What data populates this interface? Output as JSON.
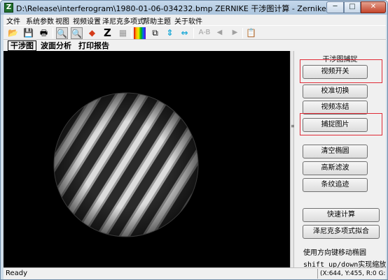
{
  "window": {
    "app_icon_letter": "Z",
    "title": "D:\\Release\\interferogram\\1980-01-06-034232.bmp ZERNIKE 干涉图计算 - Zernike 干涉仪软件",
    "controls": {
      "minimize": "─",
      "maximize": "□",
      "close": "✕"
    }
  },
  "menu": {
    "items": [
      "文件",
      "系统参数",
      "视图",
      "视频设置",
      "泽尼克多项式",
      "帮助主题",
      "关于软件"
    ]
  },
  "toolbar": {
    "buttons": [
      {
        "icon": "open-folder-icon",
        "glyph": "📂"
      },
      {
        "icon": "save-disk-icon",
        "glyph": "💾"
      },
      {
        "icon": "print-icon",
        "glyph": "🖶"
      },
      {
        "icon": "zoom-in-icon",
        "glyph": "🔍"
      },
      {
        "icon": "zoom-out-icon",
        "glyph": "🔍"
      },
      {
        "icon": "paint-icon",
        "glyph": "◆"
      },
      {
        "icon": "zernike-icon",
        "glyph": "Z"
      },
      {
        "icon": "grid-icon",
        "glyph": "▦"
      },
      {
        "icon": "color-bars-icon",
        "glyph": "▮"
      },
      {
        "icon": "cube-3d-icon",
        "glyph": "⧉"
      },
      {
        "icon": "vertical-arrows-icon",
        "glyph": "⇕"
      },
      {
        "icon": "horizontal-arrows-icon",
        "glyph": "⇔"
      },
      {
        "icon": "ab-text-icon",
        "glyph": "A-B"
      },
      {
        "icon": "prev-arrow-icon",
        "glyph": "◀"
      },
      {
        "icon": "next-arrow-icon",
        "glyph": "▶"
      },
      {
        "icon": "clipboard-icon",
        "glyph": "📋"
      }
    ]
  },
  "tabs": [
    "干涉图",
    "波面分析",
    "打印报告"
  ],
  "panel": {
    "title": "干涉图捕捉",
    "buttons": {
      "video_toggle": "视频开关",
      "calibrate_toggle": "校准切换",
      "video_freeze": "视频冻结",
      "capture_image": "捕捉图片",
      "clear_ellipse": "清空椭圆",
      "gaussian_filter": "高斯滤波",
      "fringe_tracking": "条纹追迹",
      "quick_compute": "快速计算",
      "zernike_fit": "泽尼克多项式拟合"
    },
    "hint_line1": "使用方向键移动椭圆",
    "hint_line2": "shift up/down实现缩放"
  },
  "status": {
    "left": "Ready",
    "right": "(X:644, Y:455, R:0 G:0"
  },
  "colors": {
    "highlight": "#e02a36",
    "canvas_bg": "#000000"
  }
}
